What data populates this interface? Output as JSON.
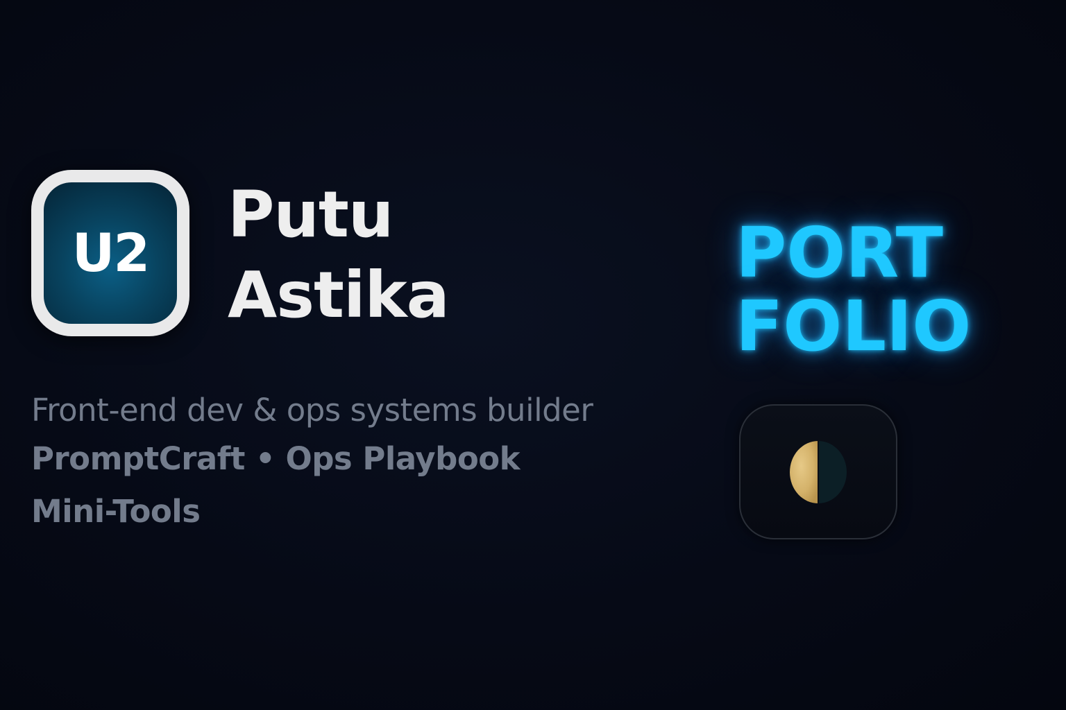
{
  "logo": {
    "text": "U2"
  },
  "name": {
    "first": "Putu",
    "last": "Astika"
  },
  "tagline": {
    "line1": "Front-end dev & ops systems builder",
    "line2": "PromptCraft • Ops Playbook",
    "line3": "Mini-Tools"
  },
  "portfolio": {
    "line1": "PORT",
    "line2": "FOLIO"
  },
  "theme_toggle": {
    "icon": "half-moon-icon"
  },
  "colors": {
    "background": "#050812",
    "accent_glow": "#1fc8ff",
    "name_text": "#eeeeee",
    "tagline_text": "#737c8c",
    "logo_frame": "#e9e9ea",
    "logo_inner": "#08435f",
    "moon_light": "#d4b26a",
    "moon_dark": "#0c1f26"
  }
}
